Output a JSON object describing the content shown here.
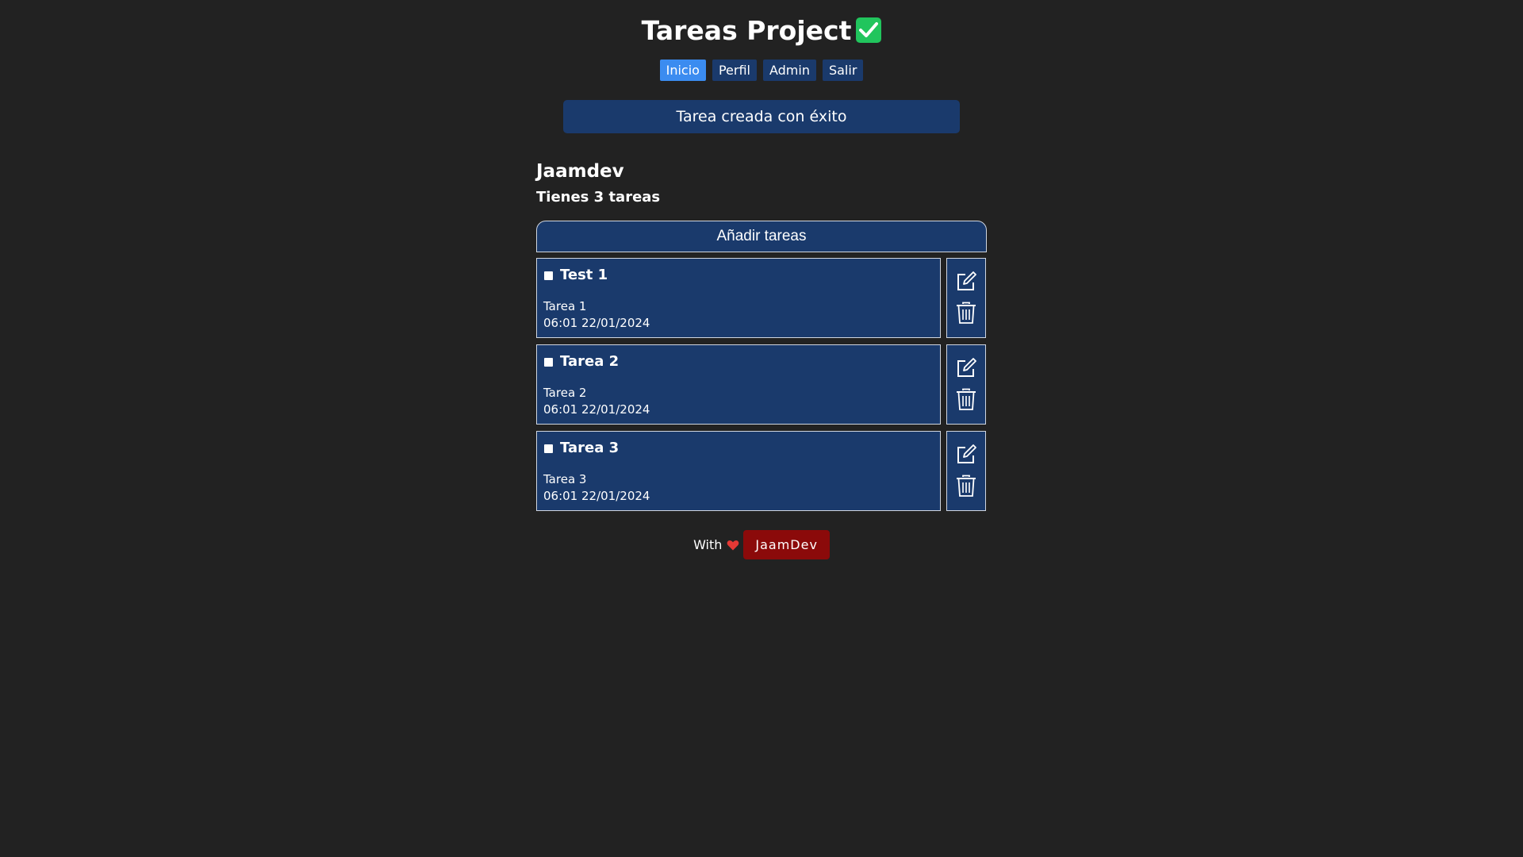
{
  "header": {
    "title": "Tareas Project",
    "title_icon": "check-mark-button-icon"
  },
  "nav": {
    "items": [
      {
        "label": "Inicio",
        "active": true
      },
      {
        "label": "Perfil",
        "active": false
      },
      {
        "label": "Admin",
        "active": false
      },
      {
        "label": "Salir",
        "active": false
      }
    ]
  },
  "alert": {
    "message": "Tarea creada con éxito"
  },
  "user": {
    "name": "Jaamdev",
    "task_count_text": "Tienes 3 tareas"
  },
  "add_button": {
    "label": "Añadir tareas"
  },
  "tasks": [
    {
      "title": "Test 1",
      "description": "Tarea 1",
      "datetime": "06:01 22/01/2024",
      "done": false
    },
    {
      "title": "Tarea 2",
      "description": "Tarea 2",
      "datetime": "06:01 22/01/2024",
      "done": false
    },
    {
      "title": "Tarea 3",
      "description": "Tarea 3",
      "datetime": "06:01 22/01/2024",
      "done": false
    }
  ],
  "footer": {
    "prefix": "With",
    "author": "JaamDev",
    "heart_icon": "heart-icon"
  },
  "colors": {
    "background": "#222222",
    "card": "#1a3a6c",
    "nav_active": "#3b8cf0",
    "check_green": "#21c55d",
    "author_red": "#8b0a0a",
    "heart": "#e53935"
  }
}
